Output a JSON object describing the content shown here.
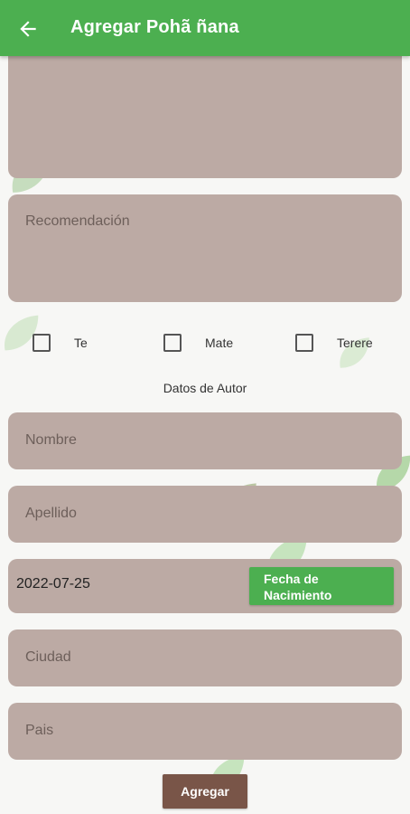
{
  "appbar": {
    "title": "Agregar Pohã ñana",
    "back_icon": "arrow-left-icon"
  },
  "form": {
    "recomendacion_placeholder": "Recomendación",
    "checkboxes": [
      {
        "label": "Te",
        "checked": false
      },
      {
        "label": "Mate",
        "checked": false
      },
      {
        "label": "Terere",
        "checked": false
      }
    ],
    "autor_section_title": "Datos de Autor",
    "nombre_placeholder": "Nombre",
    "apellido_placeholder": "Apellido",
    "fecha_value": "2022-07-25",
    "fecha_button_label": "Fecha de Nacimiento",
    "ciudad_placeholder": "Ciudad",
    "pais_placeholder": "Pais",
    "submit_label": "Agregar"
  },
  "colors": {
    "primary": "#4caf50",
    "field_bg": "#bcaaa4",
    "submit_bg": "#795548",
    "background": "#f7f7f5"
  }
}
